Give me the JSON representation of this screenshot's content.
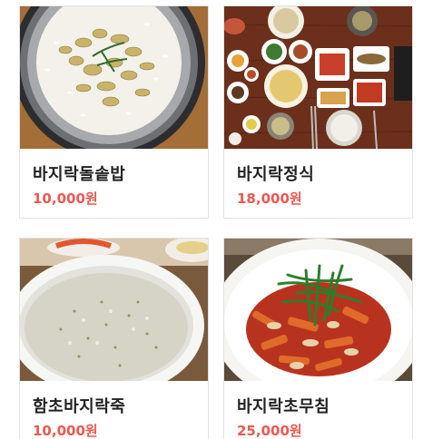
{
  "accent_color": "#f0574f",
  "menu": [
    {
      "name": "바지락돌솥밥",
      "price": "10,000원",
      "image_icon": "clam-stone-pot-rice-photo"
    },
    {
      "name": "바지락정식",
      "price": "18,000원",
      "image_icon": "clam-set-meal-table-photo"
    },
    {
      "name": "함초바지락죽",
      "price": "10,000원",
      "image_icon": "clam-porridge-bowl-photo"
    },
    {
      "name": "바지락초무침",
      "price": "25,000원",
      "image_icon": "spicy-clam-salad-photo"
    }
  ]
}
